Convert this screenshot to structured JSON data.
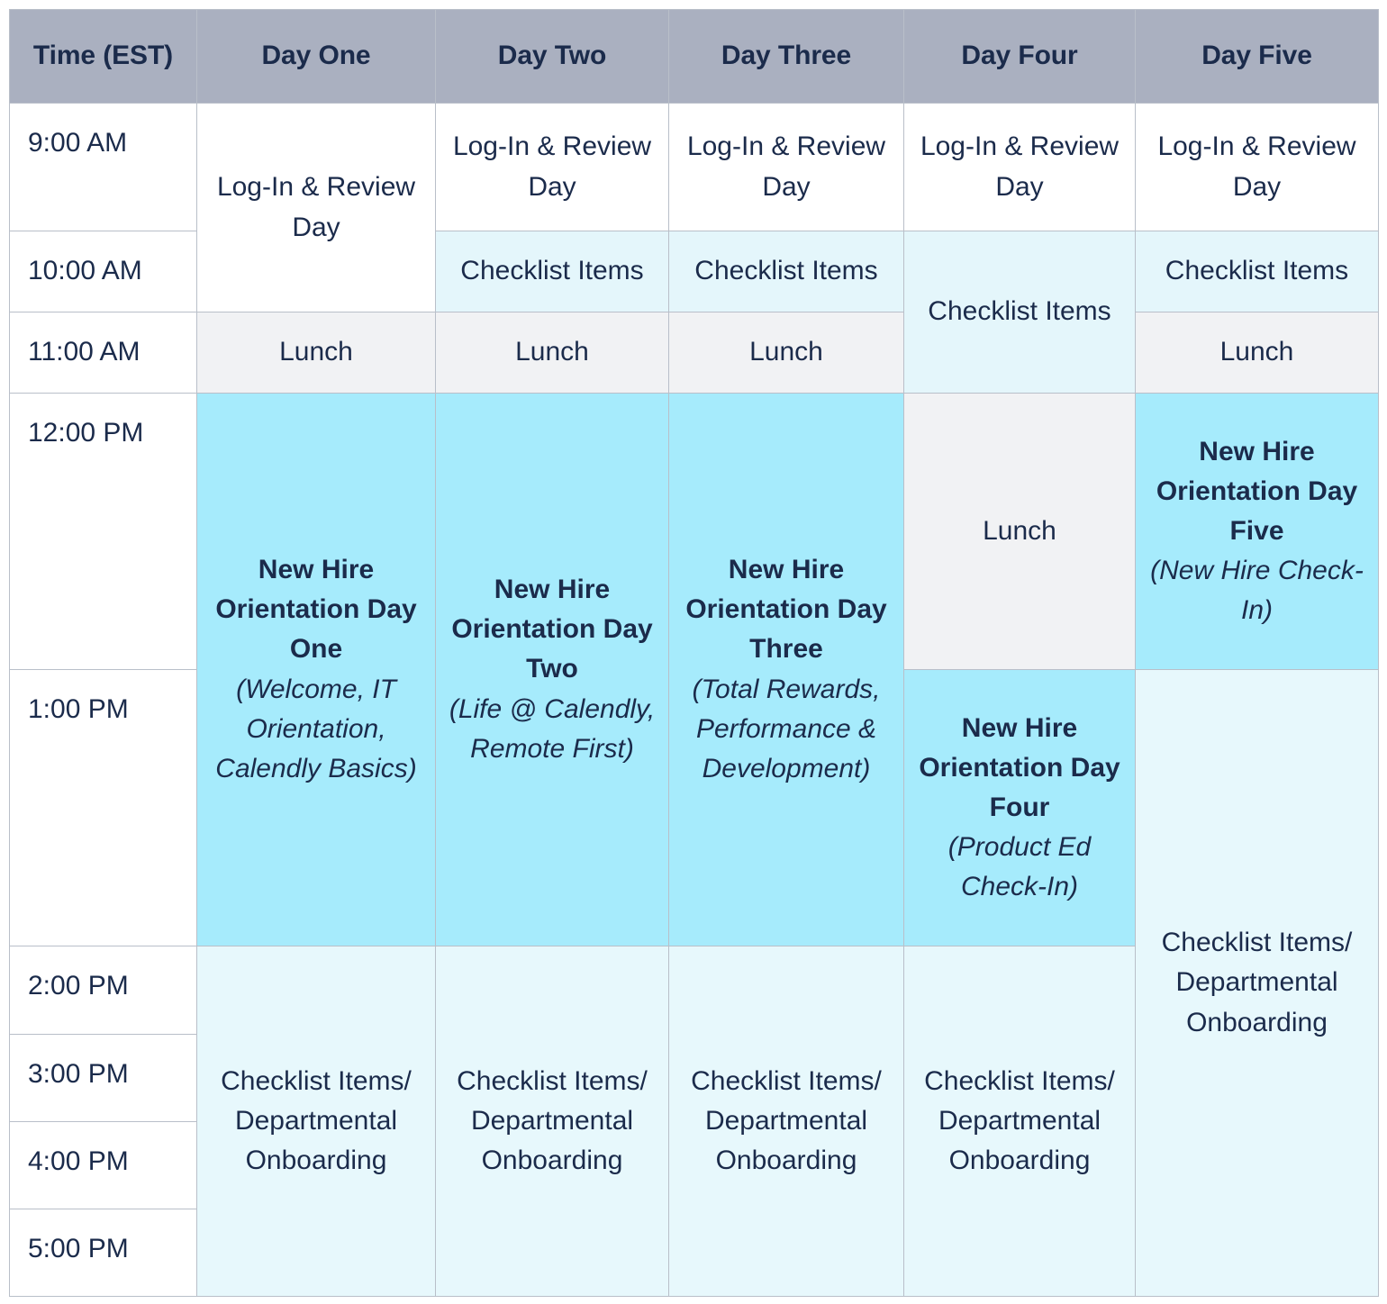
{
  "table": {
    "headers": [
      "Time (EST)",
      "Day One",
      "Day Two",
      "Day Three",
      "Day Four",
      "Day Five"
    ],
    "times": [
      "9:00 AM",
      "10:00 AM",
      "11:00 AM",
      "12:00 PM",
      "1:00 PM",
      "2:00 PM",
      "3:00 PM",
      "4:00 PM",
      "5:00 PM"
    ],
    "cells": {
      "login_review_day": "Log-In & Review Day",
      "checklist_items": "Checklist Items",
      "lunch": "Lunch",
      "checklist_departmental": "Checklist Items/ Departmental Onboarding",
      "orientation_day_one_title": "New Hire Orientation Day One",
      "orientation_day_one_sub": "(Welcome, IT Orientation, Calendly Basics)",
      "orientation_day_two_title": "New Hire Orientation Day Two",
      "orientation_day_two_sub": "(Life @ Calendly, Remote First)",
      "orientation_day_three_title": "New Hire Orientation Day Three",
      "orientation_day_three_sub": "(Total Rewards, Performance & Development)",
      "orientation_day_four_title": "New Hire Orientation Day Four",
      "orientation_day_four_sub": "(Product Ed Check-In)",
      "orientation_day_five_title": "New Hire Orientation Day Five",
      "orientation_day_five_sub": "(New Hire Check-In)"
    }
  },
  "colors": {
    "header_bg": "#aab0c0",
    "text": "#1b2b4b",
    "orientation_bg": "#a6ebfc",
    "checklist_bg": "#e4f6fb",
    "checklist_light_bg": "#e7f8fc",
    "lunch_bg": "#f1f2f4",
    "border": "#b9bfc9",
    "page_bg": "#ffffff"
  }
}
